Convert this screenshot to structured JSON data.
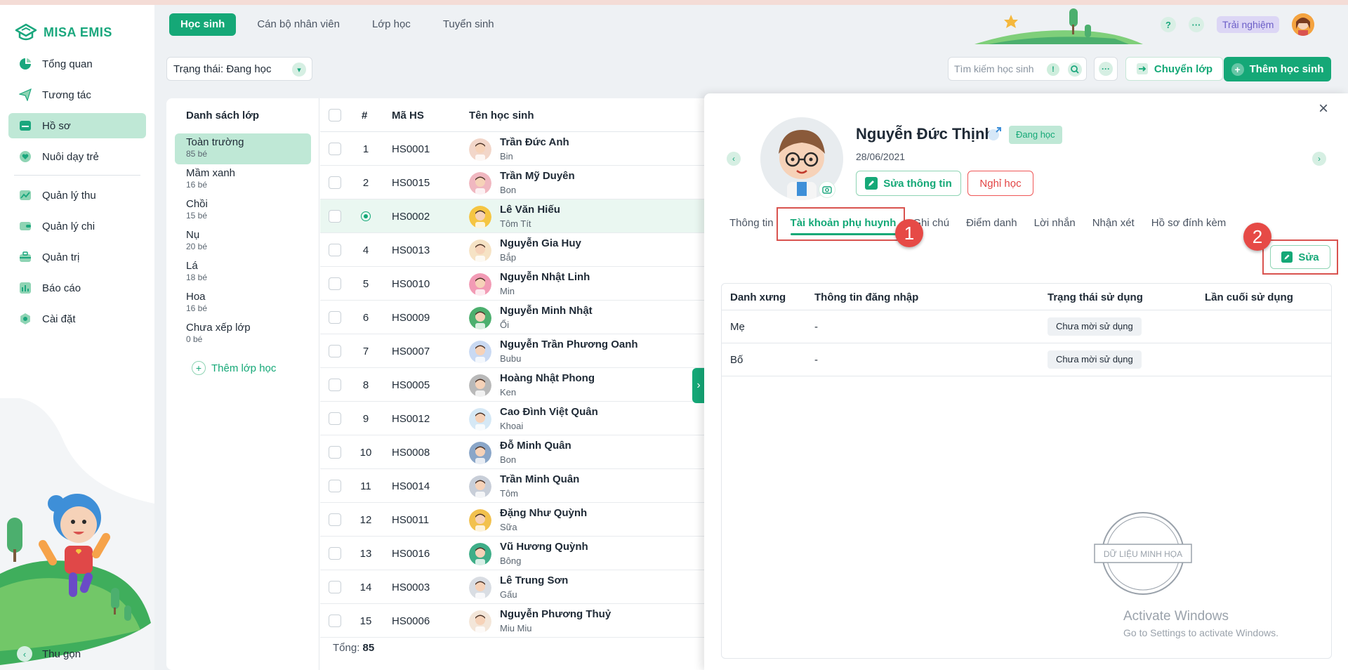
{
  "app": {
    "logo_text": "MISA EMIS",
    "brand_color": "#15a877"
  },
  "sidebar": {
    "items": [
      {
        "label": "Tổng quan",
        "icon": "dashboard-icon"
      },
      {
        "label": "Tương tác",
        "icon": "send-icon"
      },
      {
        "label": "Hồ sơ",
        "icon": "folder-icon",
        "active": true
      },
      {
        "label": "Nuôi dạy trẻ",
        "icon": "heart-icon"
      },
      {
        "label": "Quản lý thu",
        "icon": "chart-up-icon"
      },
      {
        "label": "Quản lý chi",
        "icon": "wallet-icon"
      },
      {
        "label": "Quản trị",
        "icon": "briefcase-icon"
      },
      {
        "label": "Báo cáo",
        "icon": "bar-chart-icon"
      },
      {
        "label": "Cài đặt",
        "icon": "gear-icon"
      }
    ],
    "collapse_label": "Thu gọn"
  },
  "header": {
    "tabs": [
      "Học sinh",
      "Cán bộ nhân viên",
      "Lớp học",
      "Tuyển sinh"
    ],
    "help": "?",
    "more": "···",
    "trial_label": "Trải nghiệm"
  },
  "toolbar": {
    "status_filter": "Trạng thái: Đang học",
    "search_placeholder": "Tìm kiếm học sinh",
    "info_mark": "!",
    "more": "···",
    "move_label": "Chuyển lớp",
    "add_label": "Thêm học sinh"
  },
  "classes": {
    "title": "Danh sách lớp",
    "items": [
      {
        "name": "Toàn trường",
        "count": "85 bé",
        "active": true
      },
      {
        "name": "Mầm xanh",
        "count": "16 bé"
      },
      {
        "name": "Chồi",
        "count": "15 bé"
      },
      {
        "name": "Nụ",
        "count": "20 bé"
      },
      {
        "name": "Lá",
        "count": "18 bé"
      },
      {
        "name": "Hoa",
        "count": "16 bé"
      },
      {
        "name": "Chưa xếp lớp",
        "count": "0 bé"
      }
    ],
    "add_label": "Thêm lớp học"
  },
  "students": {
    "columns": {
      "index": "#",
      "code": "Mã HS",
      "name": "Tên học sinh"
    },
    "rows": [
      {
        "index": "1",
        "code": "HS0001",
        "name": "Trần Đức Anh",
        "nickname": "Bin",
        "color": "#f2d6c9"
      },
      {
        "index": "2",
        "code": "HS0015",
        "name": "Trần Mỹ Duyên",
        "nickname": "Bon",
        "color": "#f0b7c0"
      },
      {
        "index": "",
        "code": "HS0002",
        "name": "Lê Văn Hiếu",
        "nickname": "Tôm Tít",
        "color": "#f5c542",
        "active": true
      },
      {
        "index": "4",
        "code": "HS0013",
        "name": "Nguyễn Gia Huy",
        "nickname": "Bắp",
        "color": "#f6e3c5"
      },
      {
        "index": "5",
        "code": "HS0010",
        "name": "Nguyễn Nhật Linh",
        "nickname": "Min",
        "color": "#f29bb5"
      },
      {
        "index": "6",
        "code": "HS0009",
        "name": "Nguyễn Minh Nhật",
        "nickname": "Ổi",
        "color": "#4caf6e"
      },
      {
        "index": "7",
        "code": "HS0007",
        "name": "Nguyễn Trần Phương Oanh",
        "nickname": "Bubu",
        "color": "#c9d9f2"
      },
      {
        "index": "8",
        "code": "HS0005",
        "name": "Hoàng Nhật Phong",
        "nickname": "Ken",
        "color": "#b9b9b9"
      },
      {
        "index": "9",
        "code": "HS0012",
        "name": "Cao Đình Việt Quân",
        "nickname": "Khoai",
        "color": "#d5e8f5"
      },
      {
        "index": "10",
        "code": "HS0008",
        "name": "Đỗ Minh Quân",
        "nickname": "Bon",
        "color": "#8aa6c8"
      },
      {
        "index": "11",
        "code": "HS0014",
        "name": "Trần Minh Quân",
        "nickname": "Tôm",
        "color": "#c8ced8"
      },
      {
        "index": "12",
        "code": "HS0011",
        "name": "Đặng Như Quỳnh",
        "nickname": "Sữa",
        "color": "#f2c14e"
      },
      {
        "index": "13",
        "code": "HS0016",
        "name": "Vũ Hương Quỳnh",
        "nickname": "Bông",
        "color": "#3fae88"
      },
      {
        "index": "14",
        "code": "HS0003",
        "name": "Lê Trung Sơn",
        "nickname": "Gấu",
        "color": "#d9dde3"
      },
      {
        "index": "15",
        "code": "HS0006",
        "name": "Nguyễn Phương Thuỷ",
        "nickname": "Miu Miu",
        "color": "#f3e6d9"
      }
    ],
    "total_label": "Tổng:",
    "total_value": "85"
  },
  "detail": {
    "name": "Nguyễn Đức Thịnh",
    "status": "Đang học",
    "dob": "28/06/2021",
    "edit_info_label": "Sửa thông tin",
    "leave_label": "Nghỉ học",
    "tabs": [
      "Thông tin",
      "Tài khoản phụ huynh",
      "Ghi chú",
      "Điểm danh",
      "Lời nhắn",
      "Nhận xét",
      "Hồ sơ đính kèm"
    ],
    "active_tab": 1,
    "step1": "1",
    "step2": "2",
    "edit_label": "Sửa",
    "table": {
      "columns": [
        "Danh xưng",
        "Thông tin đăng nhập",
        "Trạng thái sử dụng",
        "Lần cuối sử dụng"
      ],
      "rows": [
        {
          "title": "Mẹ",
          "login": "-",
          "status": "Chưa mời sử dụng"
        },
        {
          "title": "Bố",
          "login": "-",
          "status": "Chưa mời sử dụng"
        }
      ]
    },
    "watermark": "DỮ LIỆU MINH HỌA"
  },
  "os": {
    "activate_title": "Activate Windows",
    "activate_sub": "Go to Settings to activate Windows."
  }
}
